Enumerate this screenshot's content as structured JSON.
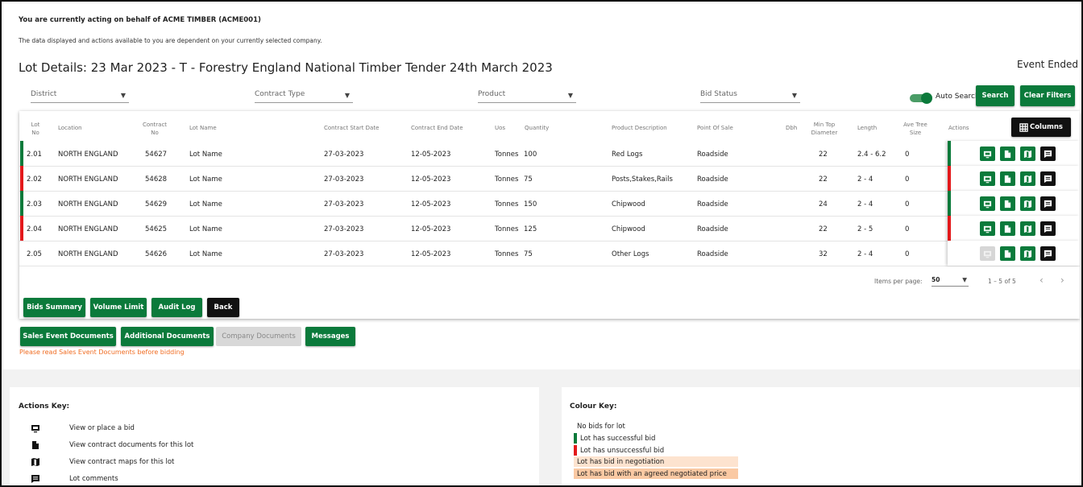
{
  "header": {
    "acting_notice": "You are currently acting on behalf of ACME TIMBER (ACME001)",
    "info_text": "The data displayed and actions available to you are dependent on your currently selected company.",
    "title": "Lot Details: 23 Mar 2023 - T - Forestry England National Timber Tender 24th March 2023",
    "event_status": "Event Ended"
  },
  "filters": {
    "district": "District",
    "contract_type": "Contract Type",
    "product": "Product",
    "bid_status": "Bid Status",
    "auto_search_label": "Auto Search",
    "auto_search_on": true,
    "search_label": "Search",
    "clear_label": "Clear Filters"
  },
  "table": {
    "headers": {
      "lot_no": "Lot No",
      "location": "Location",
      "contract_no": "Contract No",
      "lot_name": "Lot Name",
      "start": "Contract Start Date",
      "end": "Contract End Date",
      "uos": "Uos",
      "quantity": "Quantity",
      "product": "Product Description",
      "pos": "Point Of Sale",
      "dbh": "Dbh",
      "min_top": "Min Top Diameter",
      "length": "Length",
      "ave_tree": "Ave Tree Size",
      "actions": "Actions"
    },
    "columns_button": "Columns",
    "rows": [
      {
        "lot": "2.01",
        "location": "NORTH ENGLAND",
        "contract": "54627",
        "name": "Lot Name",
        "start": "27-03-2023",
        "end": "12-05-2023",
        "uos": "Tonnes",
        "qty": "100",
        "product": "Red Logs",
        "pos": "Roadside",
        "dbh": "",
        "min_top": "22",
        "length": "2.4 - 6.2",
        "ave": "0",
        "status_color": "#0b7a3b",
        "bid_enabled": true
      },
      {
        "lot": "2.02",
        "location": "NORTH ENGLAND",
        "contract": "54628",
        "name": "Lot Name",
        "start": "27-03-2023",
        "end": "12-05-2023",
        "uos": "Tonnes",
        "qty": "75",
        "product": "Posts,Stakes,Rails",
        "pos": "Roadside",
        "dbh": "",
        "min_top": "22",
        "length": "2 - 4",
        "ave": "0",
        "status_color": "#e3191b",
        "bid_enabled": true
      },
      {
        "lot": "2.03",
        "location": "NORTH ENGLAND",
        "contract": "54629",
        "name": "Lot Name",
        "start": "27-03-2023",
        "end": "12-05-2023",
        "uos": "Tonnes",
        "qty": "150",
        "product": "Chipwood",
        "pos": "Roadside",
        "dbh": "",
        "min_top": "24",
        "length": "2 - 4",
        "ave": "0",
        "status_color": "#0b7a3b",
        "bid_enabled": true
      },
      {
        "lot": "2.04",
        "location": "NORTH ENGLAND",
        "contract": "54625",
        "name": "Lot Name",
        "start": "27-03-2023",
        "end": "12-05-2023",
        "uos": "Tonnes",
        "qty": "125",
        "product": "Chipwood",
        "pos": "Roadside",
        "dbh": "",
        "min_top": "22",
        "length": "2 - 5",
        "ave": "0",
        "status_color": "#e3191b",
        "bid_enabled": true
      },
      {
        "lot": "2.05",
        "location": "NORTH ENGLAND",
        "contract": "54626",
        "name": "Lot Name",
        "start": "27-03-2023",
        "end": "12-05-2023",
        "uos": "Tonnes",
        "qty": "75",
        "product": "Other Logs",
        "pos": "Roadside",
        "dbh": "",
        "min_top": "32",
        "length": "2 - 4",
        "ave": "0",
        "status_color": "",
        "bid_enabled": false
      }
    ],
    "pagination": {
      "items_per_page_label": "Items per page:",
      "items_per_page": "50",
      "range": "1 – 5 of 5",
      "prev": "‹",
      "next": "›"
    }
  },
  "buttons": {
    "bids_summary": "Bids Summary",
    "volume_limit": "Volume Limit",
    "audit_log": "Audit Log",
    "back": "Back",
    "sales_event_docs": "Sales Event Documents",
    "additional_docs": "Additional Documents",
    "company_docs": "Company Documents",
    "messages": "Messages"
  },
  "warning": "Please read Sales Event Documents before bidding",
  "actions_key": {
    "title": "Actions Key:",
    "items": [
      {
        "icon": "bid-icon",
        "label": "View or place a bid"
      },
      {
        "icon": "document-icon",
        "label": "View contract documents for this lot"
      },
      {
        "icon": "map-icon",
        "label": "View contract maps for this lot"
      },
      {
        "icon": "comment-icon",
        "label": "Lot comments"
      }
    ]
  },
  "colour_key": {
    "title": "Colour Key:",
    "items": [
      {
        "label": "No bids for lot",
        "color": ""
      },
      {
        "label": "Lot has successful bid",
        "color": "#0b7a3b"
      },
      {
        "label": "Lot has unsuccessful bid",
        "color": "#e3191b"
      },
      {
        "label": "Lot has bid in negotiation",
        "color": "#fde3cf"
      },
      {
        "label": "Lot has bid with an agreed negotiated price",
        "color": "#fac9a3"
      }
    ]
  }
}
